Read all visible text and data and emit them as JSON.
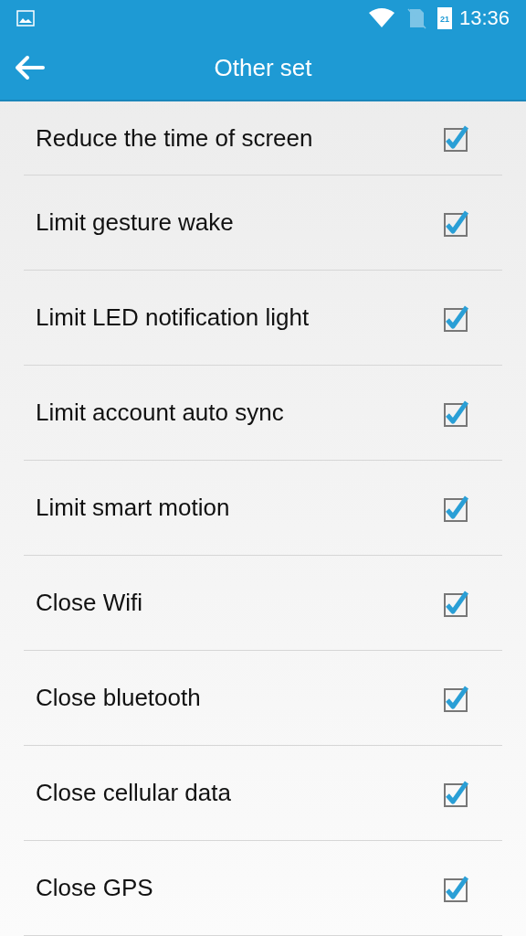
{
  "status_bar": {
    "battery_level": "21",
    "time": "13:36"
  },
  "app_bar": {
    "title": "Other set"
  },
  "settings": [
    {
      "label": "Reduce the time of screen",
      "checked": true
    },
    {
      "label": "Limit gesture wake",
      "checked": true
    },
    {
      "label": "Limit LED notification light",
      "checked": true
    },
    {
      "label": "Limit account auto sync",
      "checked": true
    },
    {
      "label": "Limit smart motion",
      "checked": true
    },
    {
      "label": "Close Wifi",
      "checked": true
    },
    {
      "label": "Close bluetooth",
      "checked": true
    },
    {
      "label": "Close cellular data",
      "checked": true
    },
    {
      "label": "Close GPS",
      "checked": true
    }
  ]
}
